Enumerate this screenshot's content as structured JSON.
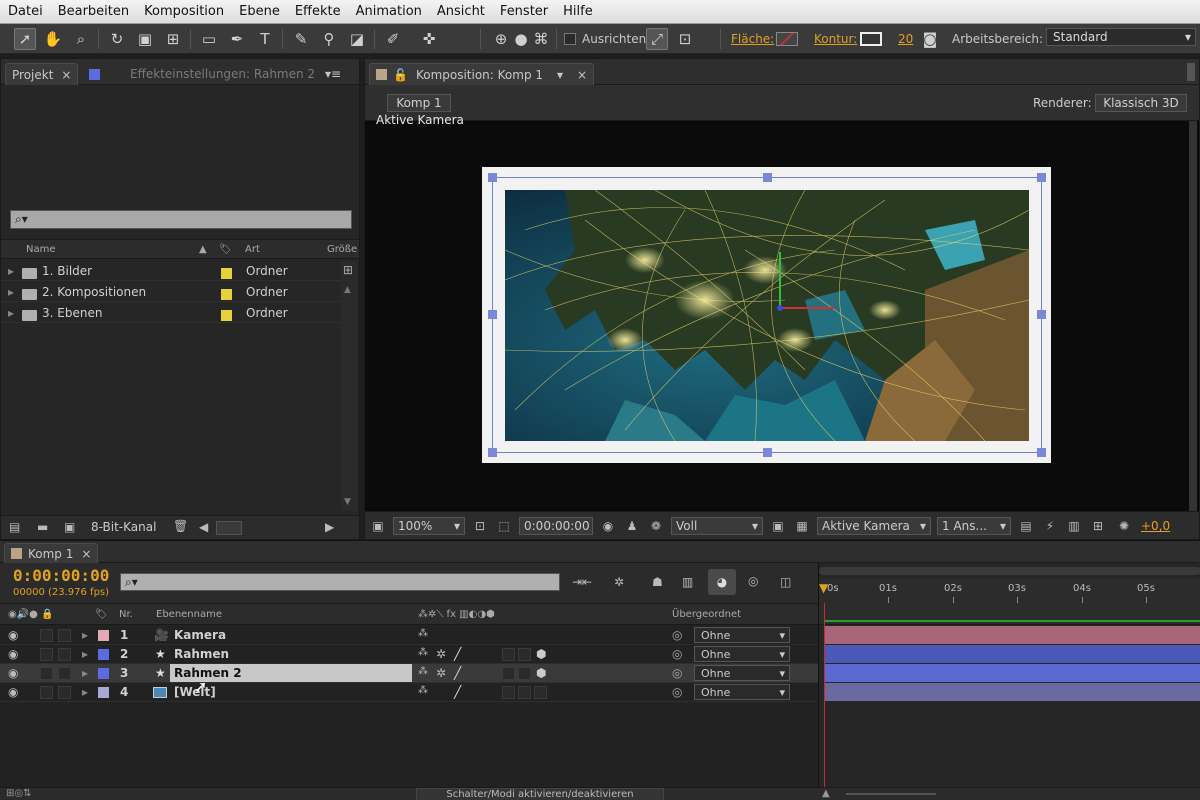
{
  "menu": [
    "Datei",
    "Bearbeiten",
    "Komposition",
    "Ebene",
    "Effekte",
    "Animation",
    "Ansicht",
    "Fenster",
    "Hilfe"
  ],
  "toolbar": {
    "align_label": "Ausrichten",
    "fill_label": "Fläche:",
    "stroke_label": "Kontur:",
    "stroke_width": "20",
    "workspace_label": "Arbeitsbereich:",
    "workspace_value": "Standard"
  },
  "project_panel": {
    "tab_project": "Projekt",
    "tab_effects": "Effekteinstellungen: Rahmen 2",
    "col_name": "Name",
    "col_type": "Art",
    "col_size": "Größe",
    "items": [
      {
        "name": "1. Bilder",
        "type": "Ordner"
      },
      {
        "name": "2. Kompositionen",
        "type": "Ordner"
      },
      {
        "name": "3. Ebenen",
        "type": "Ordner"
      }
    ],
    "bit_depth": "8-Bit-Kanal"
  },
  "comp_panel": {
    "tab_title": "Komposition: Komp 1",
    "comp_button": "Komp 1",
    "renderer_label": "Renderer:",
    "renderer_value": "Klassisch 3D",
    "active_camera": "Aktive Kamera",
    "zoom": "100%",
    "timecode": "0:00:00:00",
    "resolution": "Voll",
    "view": "Aktive Kamera",
    "view_count": "1 Ans...",
    "exposure": "+0,0"
  },
  "timeline": {
    "tab_title": "Komp 1",
    "timecode": "0:00:00:00",
    "fps": "00000 (23.976 fps)",
    "col_nr": "Nr.",
    "col_layer_name": "Ebenenname",
    "col_parent": "Übergeordnet",
    "ruler_labels": [
      "0s",
      "01s",
      "02s",
      "03s",
      "04s",
      "05s"
    ],
    "layers": [
      {
        "nr": "1",
        "name": "Kamera",
        "parent": "Ohne",
        "color": "#e3a9b9"
      },
      {
        "nr": "2",
        "name": "Rahmen",
        "parent": "Ohne",
        "color": "#5a6ce0"
      },
      {
        "nr": "3",
        "name": "Rahmen 2",
        "parent": "Ohne",
        "color": "#5a6ce0"
      },
      {
        "nr": "4",
        "name": "[Welt]",
        "parent": "Ohne",
        "color": "#a8a8d8"
      }
    ],
    "footer": "Schalter/Modi aktivieren/deaktivieren"
  },
  "colors": {
    "accent_orange": "#e4a020",
    "track_camera": "#a8657a",
    "track_rahmen": "#4a59b8",
    "track_welt": "#6a6aa0"
  }
}
